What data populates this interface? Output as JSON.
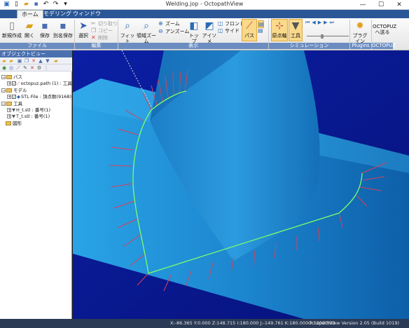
{
  "window": {
    "title": "Welding.jop - OctopathView",
    "controls": {
      "minimize": "—",
      "maximize": "☐",
      "close": "✕"
    }
  },
  "tabs": [
    {
      "label": "ホーム",
      "active": true
    },
    {
      "label": "モデリング",
      "active": false
    },
    {
      "label": "ウィンドウ",
      "active": false
    }
  ],
  "ribbon": {
    "file": {
      "new": "新規作成",
      "open": "開く",
      "save": "保存",
      "save_as": "別名保存",
      "label": "ファイル"
    },
    "edit": {
      "select": "選択",
      "cut": "切り取り",
      "copy": "コピー",
      "delete": "削除",
      "label": "編集"
    },
    "view": {
      "fit": "フィット",
      "area_zoom": "領域ズーム",
      "zoom": "ズーム",
      "zoom_out": "アンズーム",
      "top": "トップ",
      "iso": "アイソメ",
      "front": "フロント",
      "side": "サイド",
      "path": "パス",
      "label": "表示"
    },
    "simulation": {
      "origin_axis": "原点軸",
      "tool": "工具",
      "label": "シミュレーション"
    },
    "plugins": {
      "plugin": "プラグイン",
      "label": "Plugins"
    },
    "octopuz": {
      "send": "OCTOPUZ へ送る",
      "label": "OCTOPUZ"
    }
  },
  "object_view": {
    "title": "オブジェクトビュー",
    "tree": [
      {
        "label": "パス",
        "depth": 0,
        "exp": "−"
      },
      {
        "label": "octopuz.path (1) : 工具",
        "depth": 1,
        "exp": "+"
      },
      {
        "label": "モデル",
        "depth": 0,
        "exp": "−"
      },
      {
        "label": "STL File : 頂点数(9168)",
        "depth": 1,
        "exp": "+"
      },
      {
        "label": "工具",
        "depth": 0,
        "exp": "−"
      },
      {
        "label": "H_t.stl : 番号(1)",
        "depth": 1,
        "exp": "+"
      },
      {
        "label": "T_t.stl : 番号(1)",
        "depth": 1,
        "exp": "+"
      },
      {
        "label": "図形",
        "depth": 0,
        "exp": ""
      }
    ]
  },
  "status": {
    "coordinates": "X:-86.365 Y:0.000 Z:148.715 I:180.000 J:-149.761 K:180.000 F:1200.000",
    "version": "OctopathView Version 2.05 (Build 1019)"
  },
  "colors": {
    "accent": "#2b5797",
    "viewport_bg": "#0a1a9a",
    "pipe": "#1f8ed6",
    "path_line": "#7cff6b",
    "tool_vectors": "#d8405a"
  }
}
